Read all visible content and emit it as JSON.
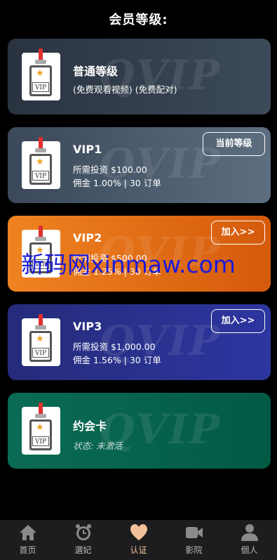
{
  "page_title": "会员等级:",
  "watermark_text": "VIP",
  "badge_tag": "VIP",
  "cards": [
    {
      "title": "普通等级",
      "lines": [
        "(免费观看视频) (免费配对)"
      ],
      "button": ""
    },
    {
      "title": "VIP1",
      "lines": [
        "所需投资 $100.00",
        "佣金 1.00% | 30 订单"
      ],
      "button": "当前等级"
    },
    {
      "title": "VIP2",
      "lines": [
        "所需投资 $500.00",
        "佣金 1.25% | 30 订单"
      ],
      "button": "加入>>"
    },
    {
      "title": "VIP3",
      "lines": [
        "所需投资 $1,000.00",
        "佣金 1.56% | 30 订单"
      ],
      "button": "加入>>"
    },
    {
      "title": "约会卡",
      "lines": [
        "状态: 未激活"
      ],
      "button": ""
    }
  ],
  "overlay_text": "新码网xinmaw.com",
  "tabs": [
    {
      "label": "首页",
      "icon": "home-icon"
    },
    {
      "label": "選妃",
      "icon": "alarm-clock-icon"
    },
    {
      "label": "认证",
      "icon": "heart-icon"
    },
    {
      "label": "影院",
      "icon": "video-camera-icon"
    },
    {
      "label": "個人",
      "icon": "user-icon"
    }
  ],
  "colors": {
    "active_tab": "#f2c09a",
    "overlay": "#1a1adc"
  }
}
